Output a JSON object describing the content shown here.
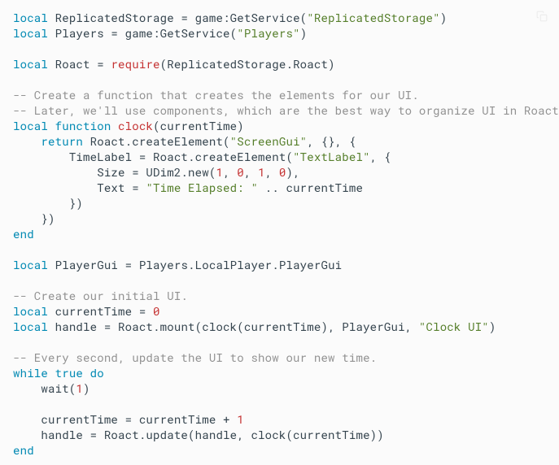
{
  "code": {
    "l1": {
      "kw1": "local",
      "plain1": " ReplicatedStorage = game:GetService(",
      "str1": "\"ReplicatedStorage\"",
      "plain2": ")"
    },
    "l2": {
      "kw1": "local",
      "plain1": " Players = game:GetService(",
      "str1": "\"Players\"",
      "plain2": ")"
    },
    "l3": "",
    "l4": {
      "kw1": "local",
      "plain1": " Roact = ",
      "fn1": "require",
      "plain2": "(ReplicatedStorage.Roact)"
    },
    "l5": "",
    "l6": {
      "com1": "-- Create a function that creates the elements for our UI."
    },
    "l7": {
      "com1": "-- Later, we'll use components, which are the best way to organize UI in Roact."
    },
    "l8": {
      "kw1": "local",
      "plain1": " ",
      "kw2": "function",
      "plain2": " ",
      "fn1": "clock",
      "plain3": "(currentTime)"
    },
    "l9": {
      "indent": "    ",
      "kw1": "return",
      "plain1": " Roact.createElement(",
      "str1": "\"ScreenGui\"",
      "plain2": ", {}, {"
    },
    "l10": {
      "indent": "        ",
      "plain1": "TimeLabel = Roact.createElement(",
      "str1": "\"TextLabel\"",
      "plain2": ", {"
    },
    "l11": {
      "indent": "            ",
      "plain1": "Size = UDim2.new(",
      "num1": "1",
      "plain2": ", ",
      "num2": "0",
      "plain3": ", ",
      "num3": "1",
      "plain4": ", ",
      "num4": "0",
      "plain5": "),"
    },
    "l12": {
      "indent": "            ",
      "plain1": "Text = ",
      "str1": "\"Time Elapsed: \"",
      "plain2": " .. currentTime"
    },
    "l13": {
      "indent": "        ",
      "plain1": "})"
    },
    "l14": {
      "indent": "    ",
      "plain1": "})"
    },
    "l15": {
      "kw1": "end"
    },
    "l16": "",
    "l17": {
      "kw1": "local",
      "plain1": " PlayerGui = Players.LocalPlayer.PlayerGui"
    },
    "l18": "",
    "l19": {
      "com1": "-- Create our initial UI."
    },
    "l20": {
      "kw1": "local",
      "plain1": " currentTime = ",
      "num1": "0"
    },
    "l21": {
      "kw1": "local",
      "plain1": " handle = Roact.mount(clock(currentTime), PlayerGui, ",
      "str1": "\"Clock UI\"",
      "plain2": ")"
    },
    "l22": "",
    "l23": {
      "com1": "-- Every second, update the UI to show our new time."
    },
    "l24": {
      "kw1": "while",
      "plain1": " ",
      "kw2": "true",
      "plain2": " ",
      "kw3": "do"
    },
    "l25": {
      "indent": "    ",
      "plain1": "wait(",
      "num1": "1",
      "plain2": ")"
    },
    "l26": "",
    "l27": {
      "indent": "    ",
      "plain1": "currentTime = currentTime + ",
      "num1": "1"
    },
    "l28": {
      "indent": "    ",
      "plain1": "handle = Roact.update(handle, clock(currentTime))"
    },
    "l29": {
      "kw1": "end"
    }
  }
}
